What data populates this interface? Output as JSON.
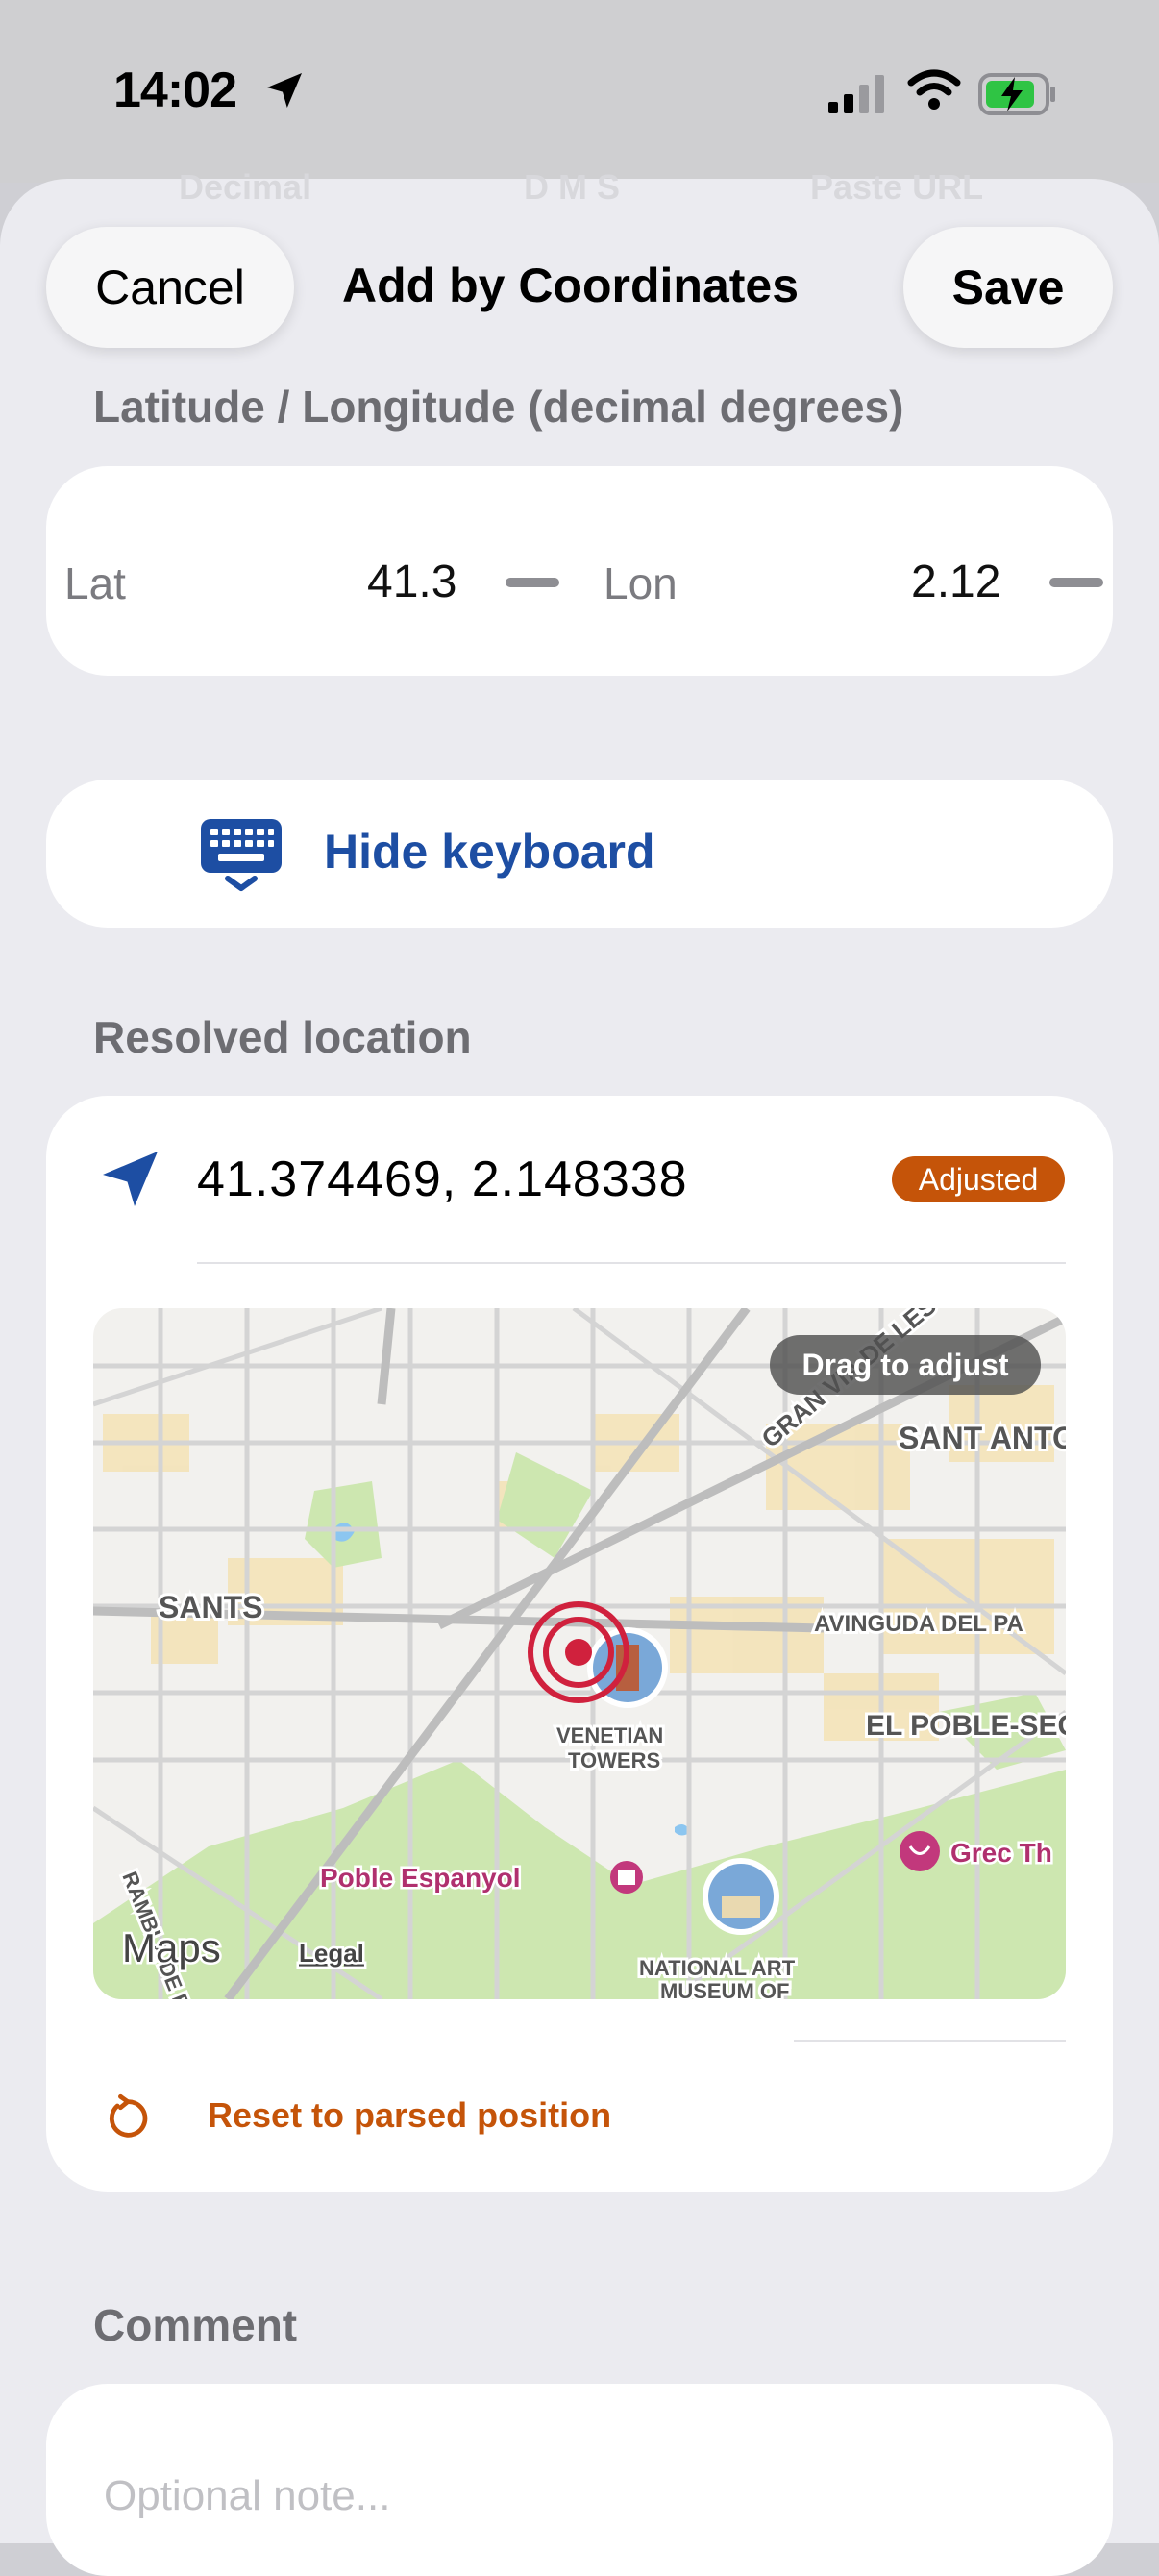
{
  "status_bar": {
    "time": "14:02",
    "icons": [
      "location-arrow-icon",
      "cellular-signal-icon",
      "wifi-icon",
      "battery-charging-icon"
    ]
  },
  "segment_tabs": [
    "Decimal",
    "D M S",
    "Paste URL"
  ],
  "nav": {
    "cancel_label": "Cancel",
    "title": "Add by Coordinates",
    "save_label": "Save"
  },
  "coordinates_section": {
    "header": "Latitude / Longitude (decimal degrees)",
    "lat_label": "Lat",
    "lat_value": "41.3",
    "lon_label": "Lon",
    "lon_value": "2.12"
  },
  "hide_keyboard": {
    "label": "Hide keyboard",
    "icon": "keyboard-down-icon"
  },
  "resolved": {
    "header": "Resolved location",
    "coordinates": "41.374469,  2.148338",
    "badge": "Adjusted",
    "map": {
      "overlay": "Drag to adjust",
      "labels": {
        "sants": "SANTS",
        "gran_via": "GRAN VIA DE LES CORTS",
        "sant_antoni": "SANT ANTONI",
        "avinguda": "AVINGUDA DEL PA",
        "poble_sec": "EL POBLE-SEC",
        "venetian_1": "VENETIAN",
        "venetian_2": "TOWERS",
        "poble_espanyol": "Poble Espanyol",
        "grec": "Grec Th",
        "museum_1": "NATIONAL ART",
        "museum_2": "MUSEUM OF",
        "rambla": "RAMBLA DE BADA",
        "maps": "Maps",
        "legal": "Legal"
      }
    },
    "reset_label": "Reset to parsed position",
    "accent_color": "#c55409"
  },
  "comment": {
    "header": "Comment",
    "placeholder": "Optional note..."
  }
}
